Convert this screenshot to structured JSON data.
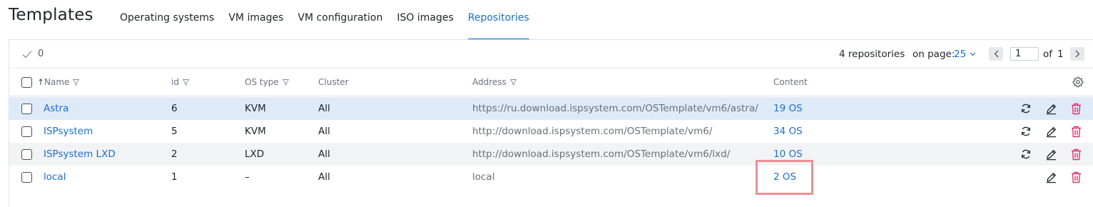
{
  "header": {
    "title": "Templates",
    "tabs": [
      {
        "label": "Operating systems",
        "active": false
      },
      {
        "label": "VM images",
        "active": false
      },
      {
        "label": "VM configuration",
        "active": false
      },
      {
        "label": "ISO images",
        "active": false
      },
      {
        "label": "Repositories",
        "active": true
      }
    ]
  },
  "toolbar": {
    "selected_count": "0",
    "total_label": "4 repositories",
    "on_page_label": "on page:",
    "on_page_value": "25",
    "page_current": "1",
    "page_of_label": "of",
    "page_total": "1"
  },
  "columns": {
    "name": "Name",
    "id": "id",
    "os_type": "OS type",
    "cluster": "Cluster",
    "address": "Address",
    "content": "Content"
  },
  "rows": [
    {
      "name": "Astra",
      "id": "6",
      "os_type": "KVM",
      "cluster": "All",
      "address": "https://ru.download.ispsystem.com/OSTemplate/vm6/astra/",
      "content": "19 OS",
      "state": "selected",
      "sync": true
    },
    {
      "name": "ISPsystem",
      "id": "5",
      "os_type": "KVM",
      "cluster": "All",
      "address": "http://download.ispsystem.com/OSTemplate/vm6/",
      "content": "34 OS",
      "state": "normal",
      "sync": true
    },
    {
      "name": "ISPsystem LXD",
      "id": "2",
      "os_type": "LXD",
      "cluster": "All",
      "address": "http://download.ispsystem.com/OSTemplate/vm6/lxd/",
      "content": "10 OS",
      "state": "alt",
      "sync": true
    },
    {
      "name": "local",
      "id": "1",
      "os_type": "–",
      "cluster": "All",
      "address": "local",
      "content": "2 OS",
      "state": "normal",
      "sync": false
    }
  ],
  "icons": {
    "check": "check-icon",
    "filter": "filter-icon",
    "sort_up": "sort-up-icon",
    "chevron_down": "chevron-down-icon",
    "chevron_left": "chevron-left-icon",
    "chevron_right": "chevron-right-icon",
    "settings": "gear-icon",
    "sync": "sync-icon",
    "edit": "pencil-icon",
    "delete": "trash-icon"
  },
  "colors": {
    "accent": "#1a6fd1",
    "delete": "#e0336b",
    "selected_row": "#dfeaf9",
    "alt_row": "#f2f3f5",
    "highlight_box": "#ec8f93"
  }
}
